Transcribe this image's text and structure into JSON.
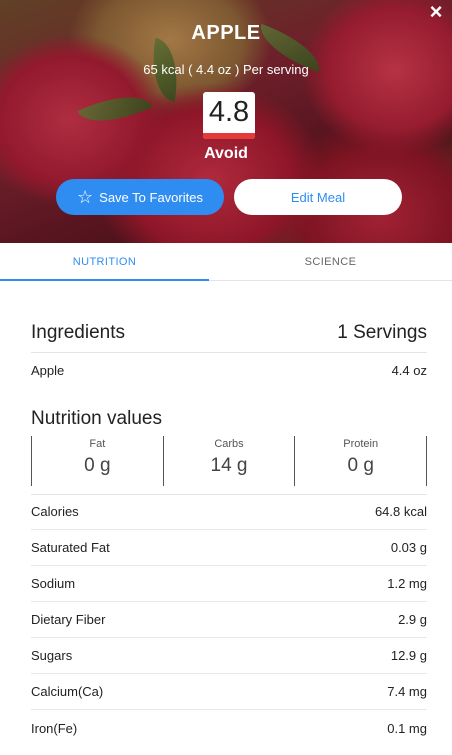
{
  "header": {
    "title": "APPLE",
    "serving": "65 kcal ( 4.4 oz ) Per serving",
    "score": "4.8",
    "verdict": "Avoid",
    "close_icon": "×",
    "favorite_label": "Save To Favorites",
    "favorite_icon": "☆",
    "edit_label": "Edit Meal"
  },
  "colors": {
    "accent": "#2f8df2",
    "score_bar": "#e33a3a"
  },
  "tabs": [
    {
      "label": "NUTRITION",
      "active": true
    },
    {
      "label": "SCIENCE",
      "active": false
    }
  ],
  "ingredients": {
    "title": "Ingredients",
    "servings": "1 Servings",
    "items": [
      {
        "name": "Apple",
        "amount": "4.4 oz"
      }
    ]
  },
  "nutrition": {
    "title": "Nutrition values",
    "macros": [
      {
        "label": "Fat",
        "value": "0 g"
      },
      {
        "label": "Carbs",
        "value": "14 g"
      },
      {
        "label": "Protein",
        "value": "0 g"
      }
    ],
    "rows": [
      {
        "name": "Calories",
        "value": "64.8 kcal"
      },
      {
        "name": "Saturated Fat",
        "value": "0.03 g"
      },
      {
        "name": "Sodium",
        "value": "1.2 mg"
      },
      {
        "name": "Dietary Fiber",
        "value": "2.9 g"
      },
      {
        "name": "Sugars",
        "value": "12.9 g"
      },
      {
        "name": "Calcium(Ca)",
        "value": "7.4 mg"
      },
      {
        "name": "Iron(Fe)",
        "value": "0.1 mg"
      }
    ]
  }
}
